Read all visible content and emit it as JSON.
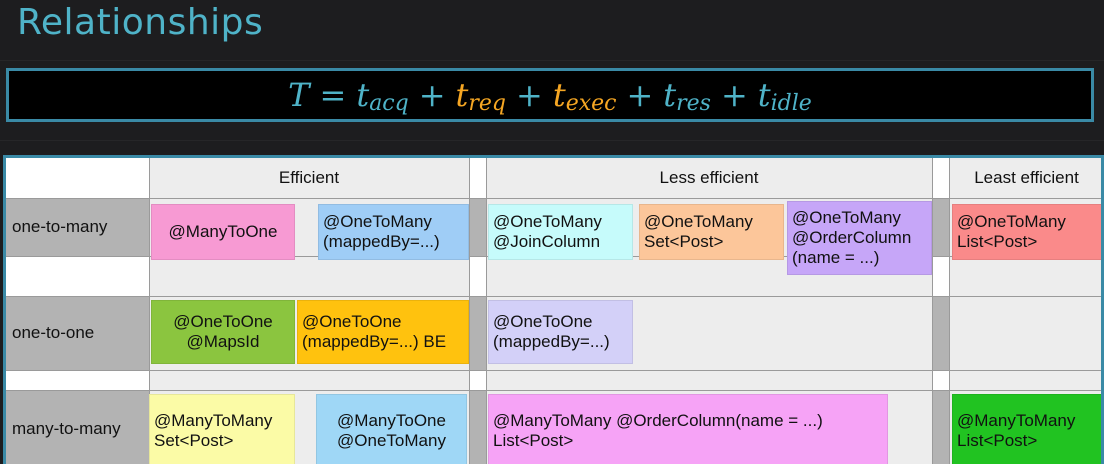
{
  "slide": {
    "title": "Relationships"
  },
  "formula": {
    "lhs": "T",
    "eq": "=",
    "plus": "+",
    "terms": [
      {
        "var": "t",
        "sub": "acq",
        "highlight": false
      },
      {
        "var": "t",
        "sub": "req",
        "highlight": true
      },
      {
        "var": "t",
        "sub": "exec",
        "highlight": true
      },
      {
        "var": "t",
        "sub": "res",
        "highlight": false
      },
      {
        "var": "t",
        "sub": "idle",
        "highlight": false
      }
    ],
    "colors": {
      "main": "#4fb3c8",
      "highlight": "#f5a623"
    }
  },
  "table": {
    "headers": {
      "efficient": "Efficient",
      "less_efficient": "Less efficient",
      "least_efficient": "Least efficient"
    },
    "rows": {
      "one_to_many": "one-to-many",
      "one_to_one": "one-to-one",
      "many_to_many": "many-to-many"
    },
    "cells": {
      "otm_manytoone": {
        "l1": "@ManyToOne",
        "color": "#f79ad3"
      },
      "otm_onetomany_mapped": {
        "l1": "@OneToMany",
        "l2": "(mappedBy=...)",
        "color": "#9fcdf6"
      },
      "otm_joincolumn": {
        "l1": "@OneToMany",
        "l2": "@JoinColumn",
        "color": "#c6fbfb"
      },
      "otm_set": {
        "l1": "@OneToMany",
        "l2": "Set<Post>",
        "color": "#fcc69a"
      },
      "otm_ordercolumn": {
        "l1": "@OneToMany",
        "l2": "@OrderColumn",
        "l3": "(name = ...)",
        "color": "#c6a6f8"
      },
      "otm_list": {
        "l1": "@OneToMany",
        "l2": "List<Post>",
        "color": "#fa8a8a"
      },
      "oto_mapsid": {
        "l1": "@OneToOne",
        "l2": "@MapsId",
        "color": "#8bc53f"
      },
      "oto_mapped_be": {
        "l1": "@OneToOne",
        "l2": "(mappedBy=...) BE",
        "color": "#ffc20e"
      },
      "oto_mapped": {
        "l1": "@OneToOne",
        "l2": "(mappedBy=...)",
        "color": "#d3d0f8"
      },
      "mtm_set": {
        "l1": "@ManyToMany",
        "l2": "Set<Post>",
        "color": "#fbfba6"
      },
      "mtm_manytoone_onetomany": {
        "l1": "@ManyToOne",
        "l2": "@OneToMany",
        "color": "#9fd7f6"
      },
      "mtm_ordercolumn_list": {
        "l1": "@ManyToMany @OrderColumn(name = ...)",
        "l2": "List<Post>",
        "color": "#f6a3f6"
      },
      "mtm_list": {
        "l1": "@ManyToMany",
        "l2": "List<Post>",
        "color": "#21c321"
      }
    }
  }
}
